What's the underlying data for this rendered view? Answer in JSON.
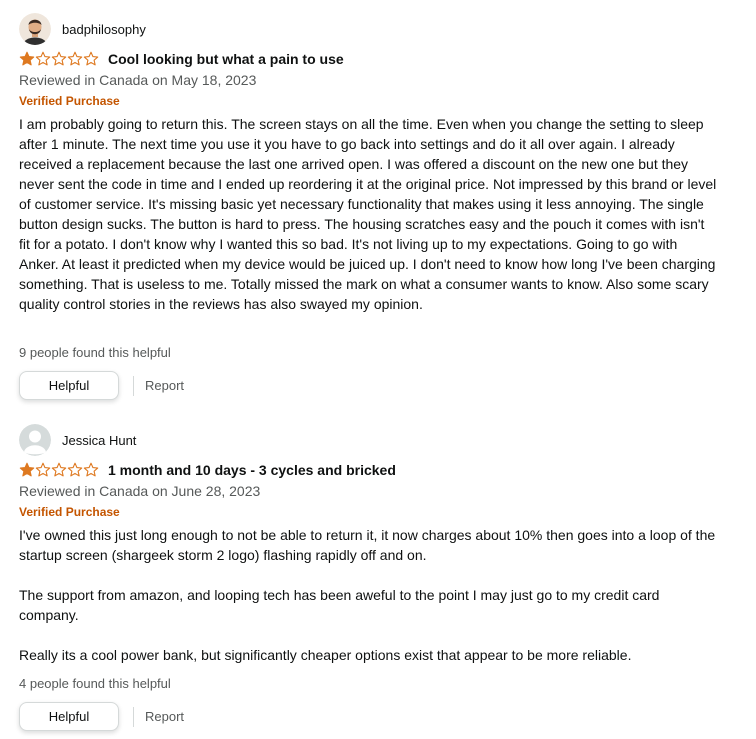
{
  "reviews": [
    {
      "author": "badphilosophy",
      "rating": 1,
      "rating_max": 5,
      "title": "Cool looking but what a pain to use",
      "meta": "Reviewed in Canada on May 18, 2023",
      "badge": "Verified Purchase",
      "body": [
        "I am probably going to return this. The screen stays on all the time. Even when you change the setting to sleep after 1 minute. The next time you use it you have to go back into settings and do it all over again. I already received a replacement because the last one arrived open. I was offered a discount on the new one but they never sent the code in time and I ended up reordering it at the original price. Not impressed by this brand or level of customer service. It's missing basic yet necessary functionality that makes using it less annoying. The single button design sucks. The button is hard to press. The housing scratches easy and the pouch it comes with isn't fit for a potato. I don't know why I wanted this so bad. It's not living up to my expectations. Going to go with Anker. At least it predicted when my device would be juiced up. I don't need to know how long I've been charging something. That is useless to me. Totally missed the mark on what a consumer wants to know. Also some scary quality control stories in the reviews has also swayed my opinion."
      ],
      "helpful_text": "9 people found this helpful",
      "helpful_button": "Helpful",
      "report_label": "Report"
    },
    {
      "author": "Jessica Hunt",
      "rating": 1,
      "rating_max": 5,
      "title": "1 month and 10 days - 3 cycles and bricked",
      "meta": "Reviewed in Canada on June 28, 2023",
      "badge": "Verified Purchase",
      "body": [
        "I've owned this just long enough to not be able to return it, it now charges about 10% then goes into a loop of the startup screen (shargeek storm 2 logo) flashing rapidly off and on.",
        "The support from amazon, and looping tech has been aweful to the point I may just go to my credit card company.",
        "Really its a cool power bank, but significantly cheaper options exist that appear to be more reliable."
      ],
      "helpful_text": "4 people found this helpful",
      "helpful_button": "Helpful",
      "report_label": "Report"
    }
  ],
  "colors": {
    "star_fill": "#de7921",
    "verified": "#c45500",
    "muted_text": "#565959"
  }
}
